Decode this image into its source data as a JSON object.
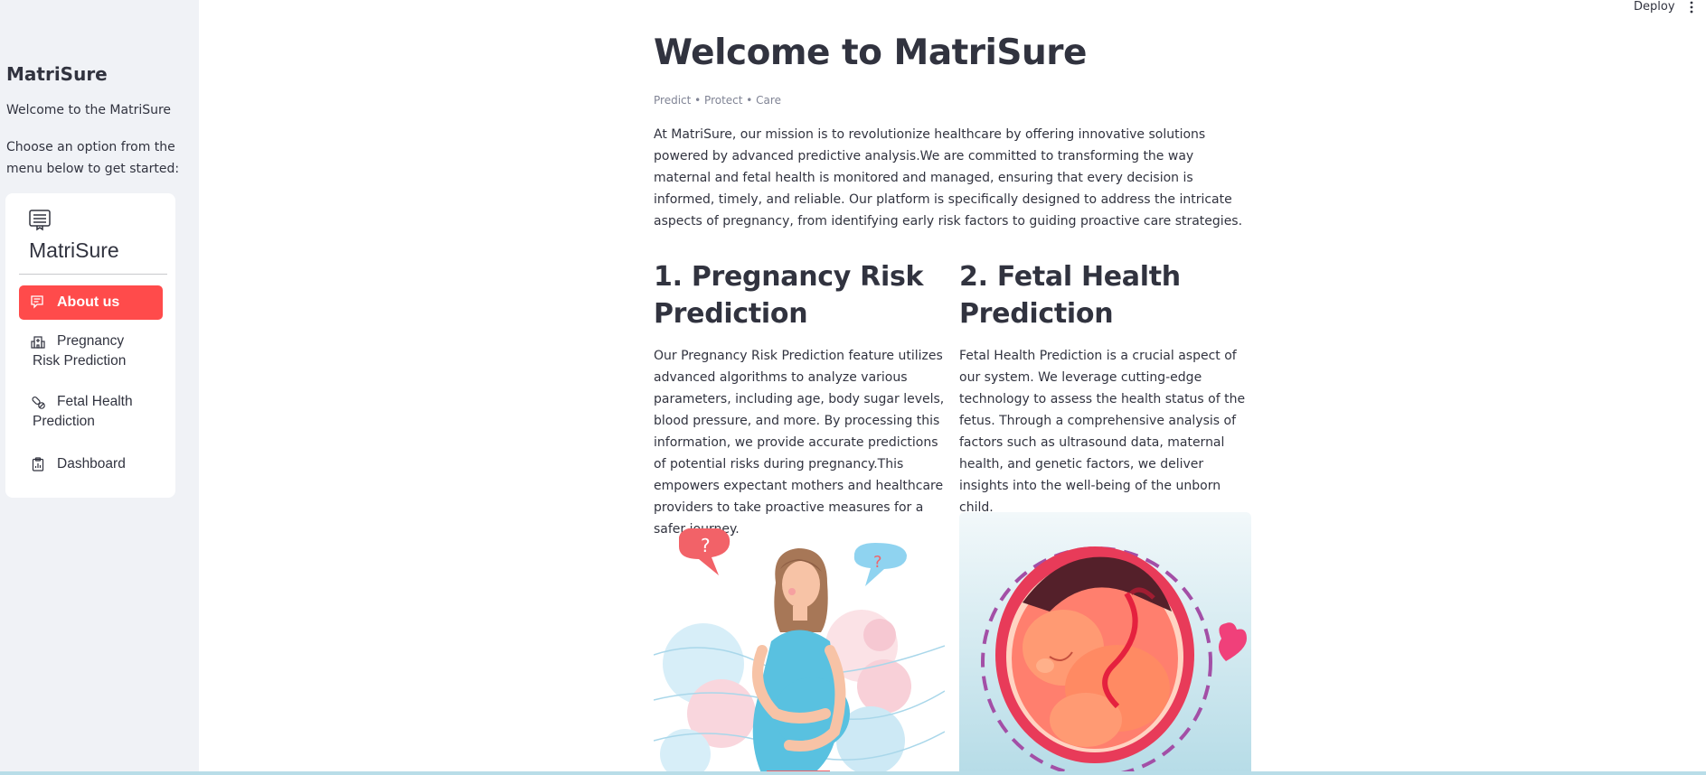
{
  "header": {
    "deploy_label": "Deploy",
    "menu_icon": "kebab-menu-icon"
  },
  "sidebar": {
    "title": "MatriSure",
    "welcome": "Welcome to the MatriSure",
    "instruction": "Choose an option from the menu below to get started:",
    "menu": {
      "logo_icon": "list-card-icon",
      "brand": "MatriSure",
      "items": [
        {
          "label": "About us",
          "icon": "chat-square-text-icon",
          "active": true
        },
        {
          "label": "Pregnancy Risk Prediction",
          "icon": "hospital-icon",
          "active": false
        },
        {
          "label": "Fetal Health Prediction",
          "icon": "capsule-icon",
          "active": false
        },
        {
          "label": "Dashboard",
          "icon": "clipboard-data-icon",
          "active": false
        }
      ]
    }
  },
  "main": {
    "title": "Welcome to MatriSure",
    "tagline": "Predict • Protect • Care",
    "intro": "At MatriSure, our mission is to revolutionize healthcare by offering innovative solutions powered by advanced predictive analysis.We are committed to transforming the way maternal and fetal health is monitored and managed, ensuring that every decision is informed, timely, and reliable. Our platform is specifically designed to address the intricate aspects of pregnancy, from identifying early risk factors to guiding proactive care strategies.",
    "sections": [
      {
        "heading": "1. Pregnancy Risk Prediction",
        "body": "Our Pregnancy Risk Prediction feature utilizes advanced algorithms to analyze various parameters, including age, body sugar levels, blood pressure, and more. By processing this information, we provide accurate predictions of potential risks during pregnancy.This empowers expectant mothers and healthcare providers to take proactive measures for a safer journey."
      },
      {
        "heading": "2. Fetal Health Prediction",
        "body": "Fetal Health Prediction is a crucial aspect of our system. We leverage cutting-edge technology to assess the health status of the fetus. Through a comprehensive analysis of factors such as ultrasound data, maternal health, and genetic factors, we deliver insights into the well-being of the unborn child."
      }
    ]
  },
  "colors": {
    "accent": "#ff4b4b",
    "sidebar_bg": "#f0f2f6",
    "text": "#31333f"
  }
}
